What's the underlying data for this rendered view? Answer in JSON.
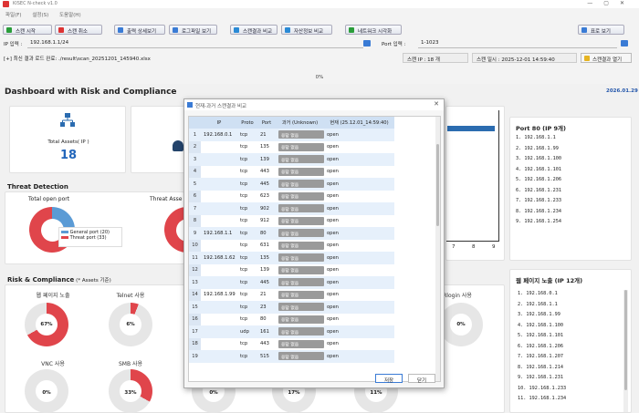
{
  "window": {
    "title": "KISEC N-check v1.0"
  },
  "menu": [
    "파일(F)",
    "설정(S)",
    "도움말(H)"
  ],
  "toolbar": {
    "start": "스캔 시작",
    "cancel": "스캔 취소",
    "detail": "출력 상세보기",
    "log": "로그파일 보기",
    "compare": "스캔결과 비교",
    "asset_compare": "자산정보 비교",
    "network": "네트워크 시각화",
    "table_view": "표로 보기"
  },
  "ip_input": {
    "label": "IP 입력 :",
    "value": "192.168.1.1/24"
  },
  "port_input": {
    "label": "Port 입력 :",
    "value": "1-1023"
  },
  "last_result": "[+] 최신 결과 로드 완료: ./result\\scan_20251201_145940.xlsx",
  "scan_ip_count": "스캔 IP : 18 개",
  "scan_time": "스캔 일시 : 2025-12-01 14:59:40",
  "open_result": "스캔결과 열기",
  "progress": "0%",
  "dashboard": {
    "title": "Dashboard with Risk and Compliance",
    "date": "2026.01.29",
    "total_assets_label": "Total Assets( IP )",
    "total_assets": "18",
    "threat_detection": "Threat Detection",
    "total_open_port": "Total open port",
    "threat_asset_prefix": "Threat Asse",
    "general_port": "General port (20)",
    "threat_port": "Threat port (33)",
    "risk_title": "Risk & Compliance",
    "risk_note": "(* Assets 기준)"
  },
  "chart_data": [
    {
      "type": "pie",
      "title": "Total open port",
      "categories": [
        "General port",
        "Threat port"
      ],
      "values": [
        20,
        33
      ],
      "colors": [
        "#5b9bd5",
        "#e0454b"
      ]
    },
    {
      "type": "pie",
      "title": "웹 페이지 노출",
      "categories": [
        "노출",
        "미노출"
      ],
      "values": [
        67,
        33
      ]
    },
    {
      "type": "pie",
      "title": "Telnet 사용",
      "categories": [
        "사용",
        "미사용"
      ],
      "values": [
        6,
        94
      ]
    },
    {
      "type": "pie",
      "title": "Rlogin 사용",
      "categories": [
        "사용",
        "미사용"
      ],
      "values": [
        0,
        100
      ]
    },
    {
      "type": "pie",
      "title": "VNC 사용",
      "categories": [
        "사용",
        "미사용"
      ],
      "values": [
        0,
        100
      ]
    },
    {
      "type": "pie",
      "title": "SMB 사용",
      "categories": [
        "사용",
        "미사용"
      ],
      "values": [
        33,
        67
      ]
    },
    {
      "type": "pie",
      "title": "",
      "categories": [
        "사용",
        "미사용"
      ],
      "values": [
        0,
        100
      ]
    },
    {
      "type": "pie",
      "title": "",
      "categories": [
        "사용",
        "미사용"
      ],
      "values": [
        17,
        83
      ]
    },
    {
      "type": "pie",
      "title": "",
      "categories": [
        "사용",
        "미사용"
      ],
      "values": [
        11,
        89
      ]
    }
  ],
  "donut_labels": {
    "web": "67%",
    "telnet": "6%",
    "rlogin": "0%",
    "vnc": "0%",
    "smb": "33%",
    "c1": "0%",
    "c2": "17%",
    "c3": "11%"
  },
  "donut_titles": {
    "web": "웹 페이지 노출",
    "telnet": "Telnet 사용",
    "rlogin": "Rlogin 사용",
    "vnc": "VNC 사용",
    "smb": "SMB 사용"
  },
  "port80": {
    "title": "Port 80 (IP 9개)",
    "items": [
      "1. 192.168.1.1",
      "2. 192.168.1.99",
      "3. 192.168.1.100",
      "4. 192.168.1.101",
      "5. 192.168.1.206",
      "6. 192.168.1.231",
      "7. 192.168.1.233",
      "8. 192.168.1.234",
      "9. 192.168.1.254"
    ]
  },
  "web_exposure": {
    "title": "웹 페이지 노출 (IP 12개)",
    "items": [
      "1. 192.168.0.1",
      "2. 192.168.1.1",
      "3. 192.168.1.99",
      "4. 192.168.1.100",
      "5. 192.168.1.101",
      "6. 192.168.1.206",
      "7. 192.168.1.207",
      "8. 192.168.1.214",
      "9. 192.168.1.231",
      "10. 192.168.1.233",
      "11. 192.168.1.234"
    ]
  },
  "axis_ticks": [
    "7",
    "8",
    "9"
  ],
  "dialog": {
    "title": "현재-과거 스캔결과 비교",
    "columns": [
      "IP",
      "Proto",
      "Port",
      "과거 (Unknown)",
      "현재 (25.12.01_14:59:40)"
    ],
    "rows": [
      [
        "1",
        "192.168.0.1",
        "tcp",
        "21",
        "응답 없음",
        "open"
      ],
      [
        "2",
        "",
        "tcp",
        "135",
        "응답 없음",
        "open"
      ],
      [
        "3",
        "",
        "tcp",
        "139",
        "응답 없음",
        "open"
      ],
      [
        "4",
        "",
        "tcp",
        "443",
        "응답 없음",
        "open"
      ],
      [
        "5",
        "",
        "tcp",
        "445",
        "응답 없음",
        "open"
      ],
      [
        "6",
        "",
        "tcp",
        "623",
        "응답 없음",
        "open"
      ],
      [
        "7",
        "",
        "tcp",
        "902",
        "응답 없음",
        "open"
      ],
      [
        "8",
        "",
        "tcp",
        "912",
        "응답 없음",
        "open"
      ],
      [
        "9",
        "192.168.1.1",
        "tcp",
        "80",
        "응답 없음",
        "open"
      ],
      [
        "10",
        "",
        "tcp",
        "631",
        "응답 없음",
        "open"
      ],
      [
        "11",
        "192.168.1.62",
        "tcp",
        "135",
        "응답 없음",
        "open"
      ],
      [
        "12",
        "",
        "tcp",
        "139",
        "응답 없음",
        "open"
      ],
      [
        "13",
        "",
        "tcp",
        "445",
        "응답 없음",
        "open"
      ],
      [
        "14",
        "192.168.1.99",
        "tcp",
        "21",
        "응답 없음",
        "open"
      ],
      [
        "15",
        "",
        "tcp",
        "23",
        "응답 없음",
        "open"
      ],
      [
        "16",
        "",
        "tcp",
        "80",
        "응답 없음",
        "open"
      ],
      [
        "17",
        "",
        "udp",
        "161",
        "응답 없음",
        "open"
      ],
      [
        "18",
        "",
        "tcp",
        "443",
        "응답 없음",
        "open"
      ],
      [
        "19",
        "",
        "tcp",
        "515",
        "응답 없음",
        "open"
      ]
    ],
    "save": "저장",
    "close": "닫기"
  }
}
